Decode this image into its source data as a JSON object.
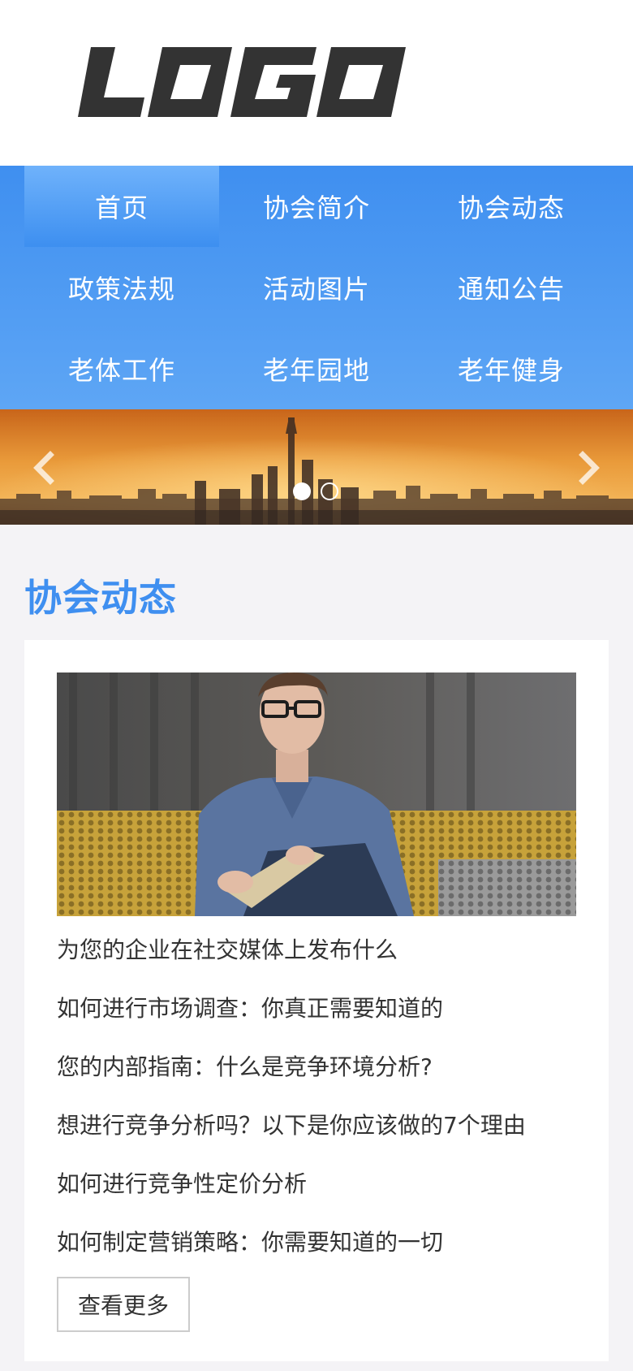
{
  "logo": {
    "text": "LOGO",
    "color": "#333333"
  },
  "nav": {
    "items": [
      {
        "label": "首页",
        "active": true
      },
      {
        "label": "协会简介"
      },
      {
        "label": "协会动态"
      },
      {
        "label": "政策法规"
      },
      {
        "label": "活动图片"
      },
      {
        "label": "通知公告"
      },
      {
        "label": "老体工作"
      },
      {
        "label": "老年园地"
      },
      {
        "label": "老年健身"
      }
    ],
    "color": "#3f8ff0"
  },
  "banner": {
    "slide_count": 2,
    "active_slide": 1,
    "prev_icon": "chevron-left-icon",
    "next_icon": "chevron-right-icon"
  },
  "section": {
    "title": "协会动态",
    "news": [
      "为您的企业在社交媒体上发布什么",
      "如何进行市场调查：你真正需要知道的",
      "您的内部指南：什么是竞争环境分析?",
      "想进行竞争分析吗？以下是你应该做的7个理由",
      "如何进行竞争性定价分析",
      "如何制定营销策略：你需要知道的一切"
    ],
    "more_label": "查看更多"
  }
}
